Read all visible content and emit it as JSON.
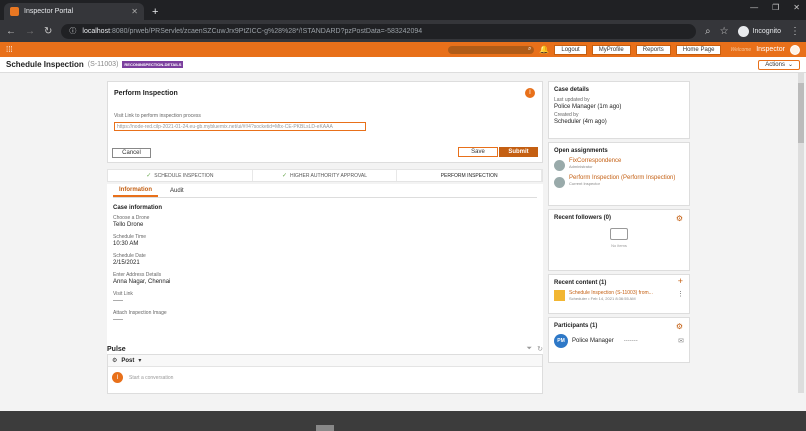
{
  "browser": {
    "tab_title": "Inspector Portal",
    "tab_close": "✕",
    "new_tab": "+",
    "url_host": "localhost",
    "url_path": ":8080/prweb/PRServlet/zcaenSZCuwJrx9PtZICC-g%28%28*/!STANDARD?pzPostData=-583242094",
    "profile": "Incognito"
  },
  "appbar": {
    "buttons": [
      "Logout",
      "MyProfile",
      "Reports",
      "Home Page"
    ],
    "welcome": "Welcome",
    "user": "Inspector"
  },
  "case_header": {
    "title": "Schedule Inspection",
    "case_id": "(S-11003)",
    "badge": "RECONINSPECTION-DETAILS",
    "actions": "Actions"
  },
  "perform": {
    "title": "Perform Inspection",
    "link_label": "Visit Link to perform inspection process",
    "link_value": "https://node-red.cilp-2021-01-24.eu-gb.mybluemix.net/ui/#!/4?socketid=Mtx-CE-PKBLsLD-eKAAA",
    "cancel": "Cancel",
    "save": "Save",
    "submit": "Submit",
    "badge": "I"
  },
  "stages": [
    {
      "label": "SCHEDULE INSPECTION",
      "done": true
    },
    {
      "label": "HIGHER AUTHORITY APPROVAL",
      "done": true
    },
    {
      "label": "PERFORM INSPECTION",
      "done": false
    }
  ],
  "tabs": [
    "Information",
    "Audit"
  ],
  "case_info": {
    "heading": "Case information",
    "fields": [
      {
        "label": "Choose a Drone",
        "value": "Tello Drone"
      },
      {
        "label": "Schedule Time",
        "value": "10:30 AM"
      },
      {
        "label": "Schedule Date",
        "value": "2/15/2021"
      },
      {
        "label": "Enter Address Details",
        "value": "Anna Nagar, Chennai"
      },
      {
        "label": "Visit Link",
        "value": "-----"
      },
      {
        "label": "Attach Inspection Image",
        "value": "-----"
      }
    ]
  },
  "pulse": {
    "title": "Pulse",
    "post": "Post",
    "placeholder": "Start a conversation",
    "avatar": "I"
  },
  "side": {
    "case_details": {
      "title": "Case details",
      "updated_label": "Last updated by",
      "updated_value": "Police Manager (1m ago)",
      "created_label": "Created by",
      "created_value": "Scheduler (4m ago)"
    },
    "assignments": {
      "title": "Open assignments",
      "items": [
        {
          "name": "FixCorrespondence",
          "role": "Administrator"
        },
        {
          "name": "Perform Inspection (Perform Inspection)",
          "role": "Current Inspector"
        }
      ]
    },
    "followers": {
      "title": "Recent followers (0)",
      "empty": "No items"
    },
    "recent": {
      "title": "Recent content (1)",
      "item": "Schedule Inspection (S-11003) from...",
      "meta": "Scheduler  •  Feb 14, 2021 8:36:55 AM"
    },
    "participants": {
      "title": "Participants (1)",
      "initials": "PM",
      "name": "Police Manager",
      "dash": "-------"
    }
  }
}
